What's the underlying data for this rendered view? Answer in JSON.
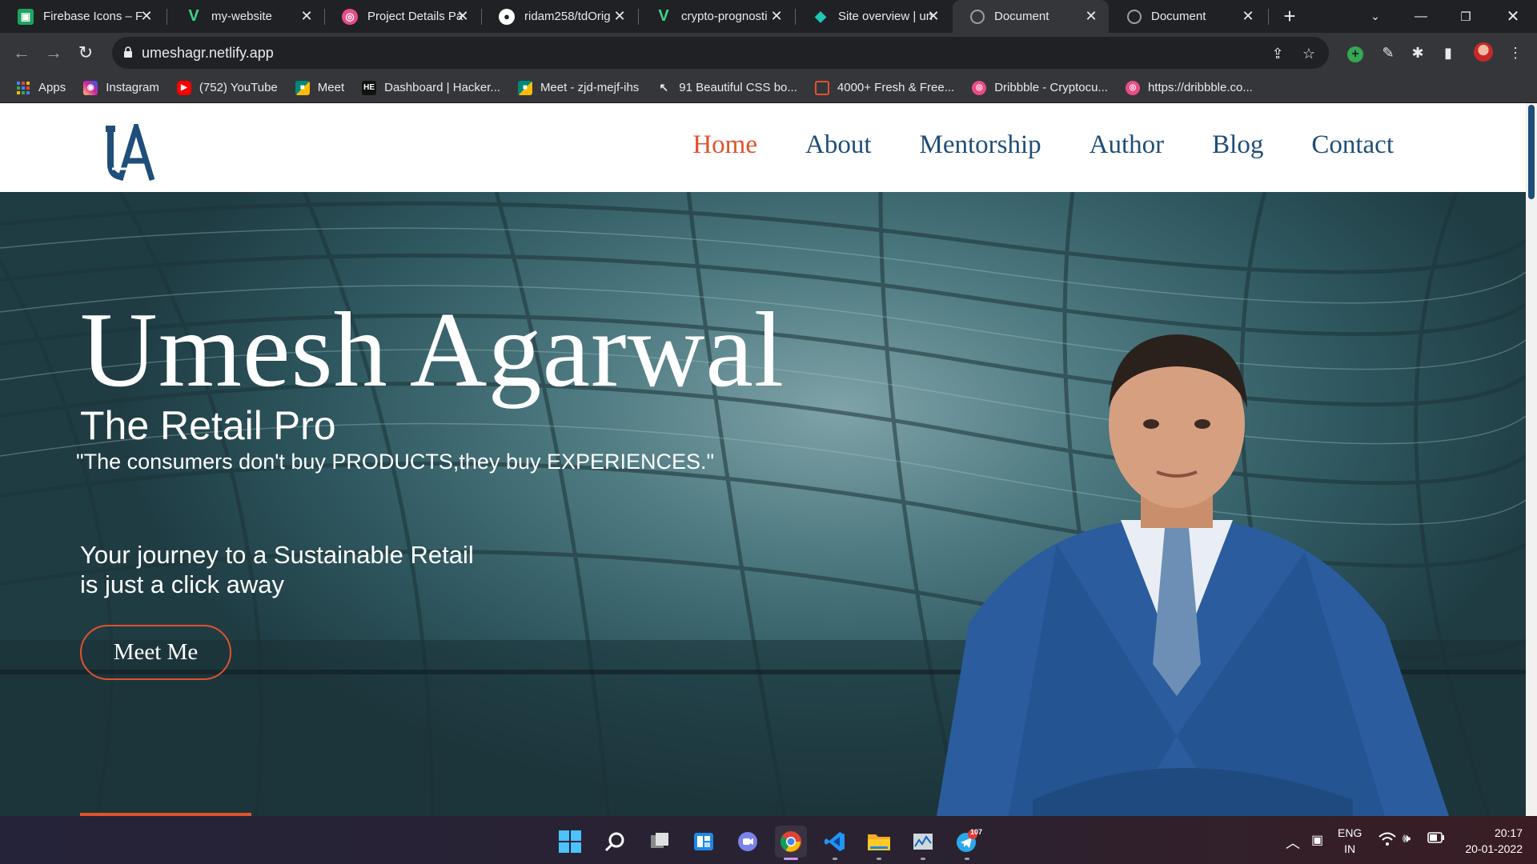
{
  "browser": {
    "tabs": [
      {
        "title": "Firebase Icons – F",
        "favicon": "firebase-icon",
        "color": "#1da462"
      },
      {
        "title": "my-website",
        "favicon": "vercel-icon",
        "color": "#3dd68c"
      },
      {
        "title": "Project Details Pa",
        "favicon": "dribbble-icon",
        "color": "#ea4c89"
      },
      {
        "title": "ridam258/tdOrig",
        "favicon": "github-icon",
        "color": "#ffffff"
      },
      {
        "title": "crypto-prognosti",
        "favicon": "vercel-icon",
        "color": "#3dd68c"
      },
      {
        "title": "Site overview | un",
        "favicon": "netlify-icon",
        "color": "#20c6b7"
      },
      {
        "title": "Document",
        "favicon": "globe-icon",
        "color": "#9aa0a6",
        "active": true
      },
      {
        "title": "Document",
        "favicon": "globe-icon",
        "color": "#9aa0a6"
      }
    ],
    "url": "umeshagr.netlify.app",
    "bookmarks": [
      {
        "label": "Apps",
        "icon": "apps-grid-icon",
        "color": "#4285f4"
      },
      {
        "label": "Instagram",
        "icon": "instagram-icon",
        "color": "#d6249f"
      },
      {
        "label": "(752) YouTube",
        "icon": "youtube-icon",
        "color": "#ff0000"
      },
      {
        "label": "Meet",
        "icon": "meet-icon",
        "color": "#00897b"
      },
      {
        "label": "Dashboard | Hacker...",
        "icon": "hackerearth-icon",
        "color": "#2c3454"
      },
      {
        "label": "Meet - zjd-mejf-ihs",
        "icon": "meet-icon",
        "color": "#00897b"
      },
      {
        "label": "91 Beautiful CSS bo...",
        "icon": "cursor-icon",
        "color": "#555555"
      },
      {
        "label": "4000+ Fresh & Free...",
        "icon": "bookmark-page-icon",
        "color": "#e2522c"
      },
      {
        "label": "Dribbble - Cryptocu...",
        "icon": "dribbble-icon",
        "color": "#ea4c89"
      },
      {
        "label": "https://dribbble.co...",
        "icon": "dribbble-icon",
        "color": "#ea4c89"
      }
    ]
  },
  "site": {
    "nav": [
      {
        "label": "Home",
        "active": true
      },
      {
        "label": "About"
      },
      {
        "label": "Mentorship"
      },
      {
        "label": "Author"
      },
      {
        "label": "Blog"
      },
      {
        "label": "Contact"
      }
    ],
    "hero": {
      "name": "Umesh Agarwal",
      "subtitle": "The Retail Pro",
      "quote": "\"The consumers don't buy PRODUCTS,they buy EXPERIENCES.\"",
      "tagline_line1": "Your journey to a Sustainable Retail",
      "tagline_line2": "is just a click away",
      "cta": "Meet Me"
    },
    "colors": {
      "accent": "#e2522c",
      "brand": "#1f4e79"
    }
  },
  "taskbar": {
    "apps": [
      "windows-start-icon",
      "search-icon",
      "task-view-icon",
      "widgets-icon",
      "teams-chat-icon",
      "chrome-icon",
      "vscode-icon",
      "file-explorer-icon",
      "resource-monitor-icon",
      "telegram-icon"
    ],
    "telegram_badge": "107",
    "language_line1": "ENG",
    "language_line2": "IN",
    "time": "20:17",
    "date": "20-01-2022"
  }
}
